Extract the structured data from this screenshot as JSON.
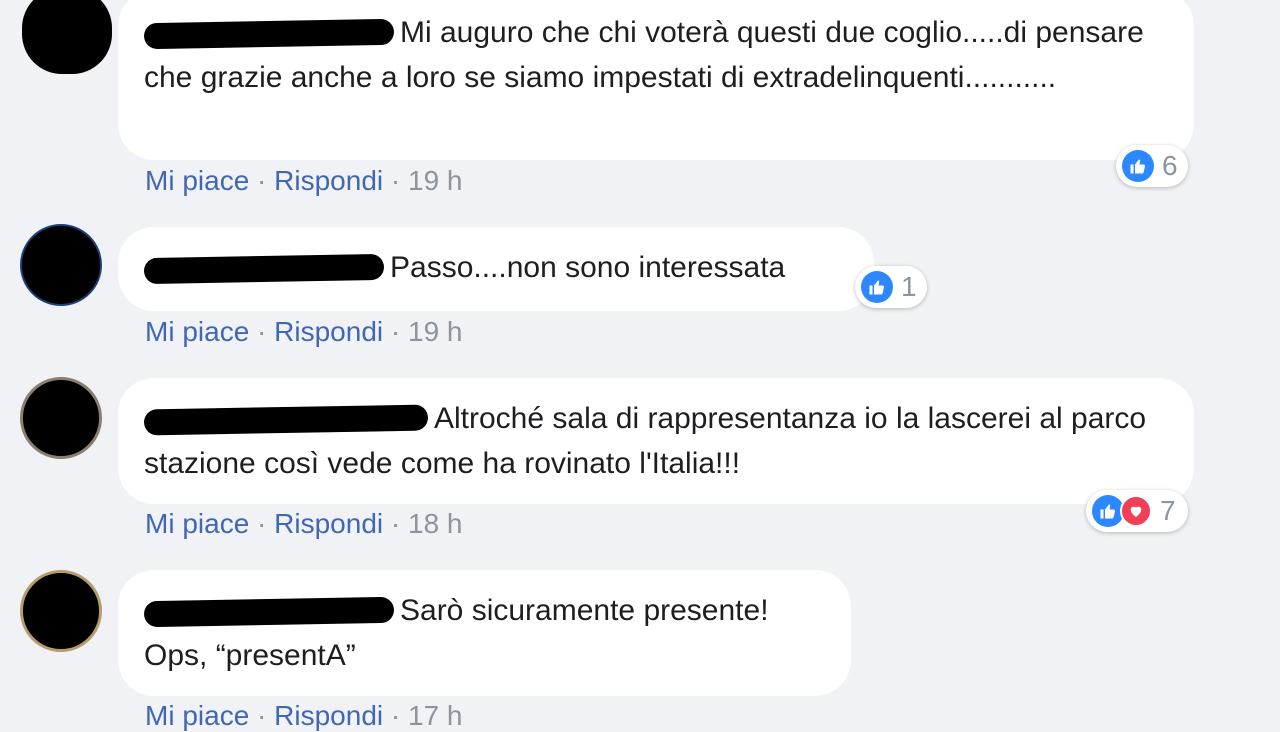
{
  "comments": [
    {
      "text": "Mi auguro che chi voterà questi due coglio.....di pensare che grazie anche a loro se siamo impestati di extradelinquenti...........",
      "like_label": "Mi piace",
      "separator": "·",
      "reply_label": "Rispondi",
      "time": "19 h",
      "reaction_count": "6",
      "reactions": [
        "like-icon"
      ]
    },
    {
      "text": "Passo....non sono interessata",
      "like_label": "Mi piace",
      "separator": "·",
      "reply_label": "Rispondi",
      "time": "19 h",
      "reaction_count": "1",
      "reactions": [
        "like-icon"
      ]
    },
    {
      "text": "Altroché sala di rappresentanza io la lascerei al parco stazione così vede come ha rovinato l'Italia!!!",
      "like_label": "Mi piace",
      "separator": "·",
      "reply_label": "Rispondi",
      "time": "18 h",
      "reaction_count": "7",
      "reactions": [
        "like-icon",
        "love-icon"
      ]
    },
    {
      "text": "Sarò sicuramente presente! Ops, “presentA”",
      "like_label": "Mi piace",
      "separator": "·",
      "reply_label": "Rispondi",
      "time": "17 h"
    }
  ],
  "colors": {
    "background": "#f0f2f5",
    "link": "#4267b2",
    "meta": "#8d949e",
    "like": "#2d88ff",
    "love": "#f33e58"
  }
}
